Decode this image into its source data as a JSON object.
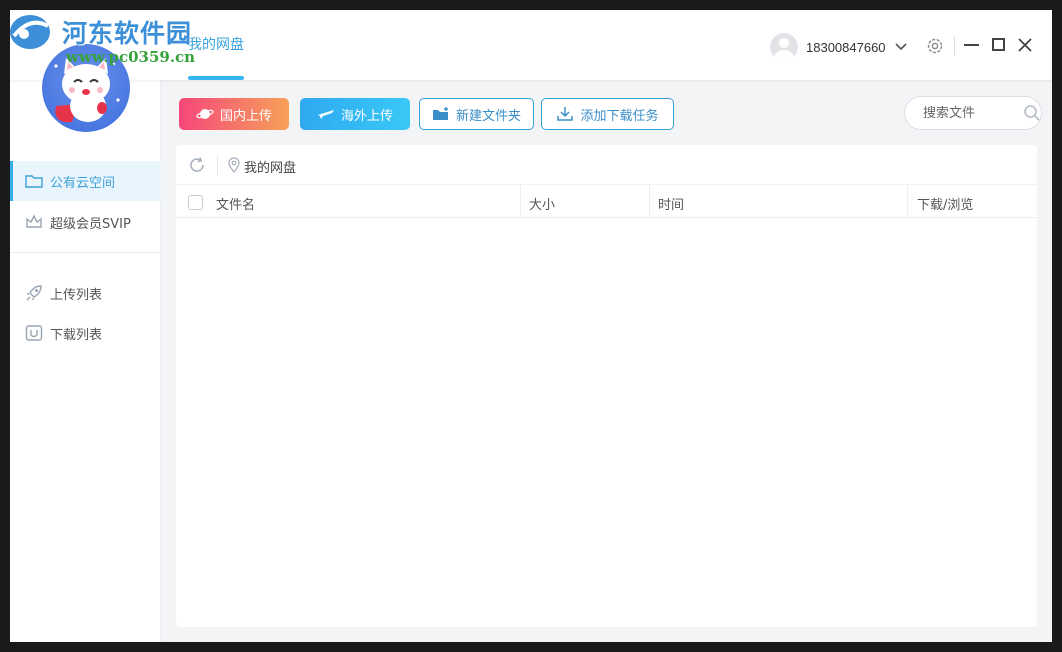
{
  "watermark": {
    "title": "河东软件园",
    "url": "www.pc0359.cn"
  },
  "header": {
    "tab_label": "我的网盘",
    "username": "18300847660"
  },
  "sidebar": {
    "items": [
      {
        "label": "公有云空间",
        "icon": "folder-icon",
        "active": true
      },
      {
        "label": "超级会员SVIP",
        "icon": "crown-icon",
        "active": false
      },
      {
        "label": "上传列表",
        "icon": "rocket-icon",
        "active": false
      },
      {
        "label": "下载列表",
        "icon": "download-box-icon",
        "active": false
      }
    ]
  },
  "toolbar": {
    "upload_domestic": "国内上传",
    "upload_overseas": "海外上传",
    "new_folder": "新建文件夹",
    "add_download": "添加下载任务",
    "search_placeholder": "搜索文件"
  },
  "file_panel": {
    "path": "我的网盘",
    "columns": [
      "文件名",
      "大小",
      "时间",
      "下载/浏览"
    ],
    "rows": []
  },
  "colors": {
    "accent": "#34b7f0",
    "domestic_gradient": [
      "#f5477a",
      "#f7a15a"
    ],
    "overseas_gradient": [
      "#2fa9f0",
      "#39c8f6"
    ]
  }
}
